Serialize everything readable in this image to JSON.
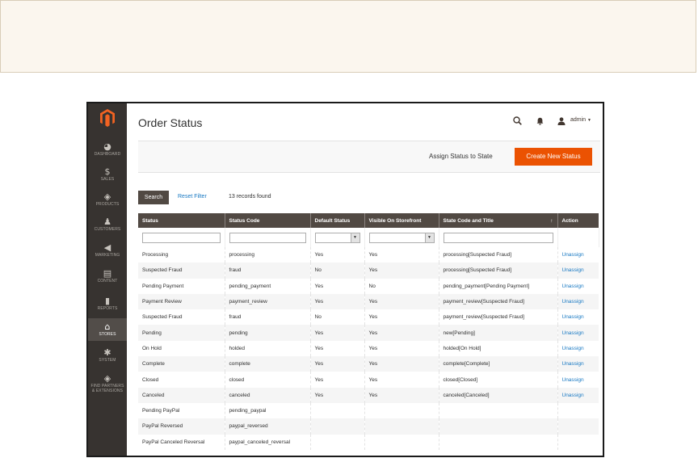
{
  "header": {
    "page_title": "Order Status",
    "user": "admin",
    "icons": {
      "search": "search-icon",
      "notifications": "bell-icon",
      "user": "user-icon"
    }
  },
  "sidebar": {
    "items": [
      {
        "label": "DASHBOARD",
        "icon": "dashboard-icon"
      },
      {
        "label": "SALES",
        "icon": "dollar-icon"
      },
      {
        "label": "PRODUCTS",
        "icon": "cube-icon"
      },
      {
        "label": "CUSTOMERS",
        "icon": "person-icon"
      },
      {
        "label": "MARKETING",
        "icon": "megaphone-icon"
      },
      {
        "label": "CONTENT",
        "icon": "layout-icon"
      },
      {
        "label": "REPORTS",
        "icon": "bar-chart-icon"
      },
      {
        "label": "STORES",
        "icon": "store-icon",
        "active": true
      },
      {
        "label": "SYSTEM",
        "icon": "gear-icon"
      },
      {
        "label1": "FIND PARTNERS",
        "label2": "& EXTENSIONS",
        "icon": "box-icon"
      }
    ]
  },
  "actions": {
    "assign_status": "Assign Status to State",
    "create_new_status": "Create New Status"
  },
  "toolbar": {
    "search": "Search",
    "reset_filter": "Reset Filter",
    "records_found": "13 records found"
  },
  "grid": {
    "columns": [
      "Status",
      "Status Code",
      "Default Status",
      "Visible On Storefront",
      "State Code and Title",
      "Action"
    ],
    "rows": [
      [
        "Processing",
        "processing",
        "Yes",
        "Yes",
        "processing[Suspected Fraud]",
        "Unassign"
      ],
      [
        "Suspected Fraud",
        "fraud",
        "No",
        "Yes",
        "processing[Suspected Fraud]",
        "Unassign"
      ],
      [
        "Pending Payment",
        "pending_payment",
        "Yes",
        "No",
        "pending_payment[Pending Payment]",
        "Unassign"
      ],
      [
        "Payment Review",
        "payment_review",
        "Yes",
        "Yes",
        "payment_review[Suspected Fraud]",
        "Unassign"
      ],
      [
        "Suspected Fraud",
        "fraud",
        "No",
        "Yes",
        "payment_review[Suspected Fraud]",
        "Unassign"
      ],
      [
        "Pending",
        "pending",
        "Yes",
        "Yes",
        "new[Pending]",
        "Unassign"
      ],
      [
        "On Hold",
        "holded",
        "Yes",
        "Yes",
        "holded[On Hold]",
        "Unassign"
      ],
      [
        "Complete",
        "complete",
        "Yes",
        "Yes",
        "complete[Complete]",
        "Unassign"
      ],
      [
        "Closed",
        "closed",
        "Yes",
        "Yes",
        "closed[Closed]",
        "Unassign"
      ],
      [
        "Canceled",
        "canceled",
        "Yes",
        "Yes",
        "canceled[Canceled]",
        "Unassign"
      ],
      [
        "Pending PayPal",
        "pending_paypal",
        "",
        "",
        "",
        ""
      ],
      [
        "PayPal Reversed",
        "paypal_reversed",
        "",
        "",
        "",
        ""
      ],
      [
        "PayPal Canceled Reversal",
        "paypal_canceled_reversal",
        "",
        "",
        "",
        ""
      ]
    ]
  },
  "colors": {
    "sidebar_bg": "#373330",
    "accent_orange": "#eb5202",
    "header_row_bg": "#514943",
    "link_blue": "#1979c3"
  }
}
